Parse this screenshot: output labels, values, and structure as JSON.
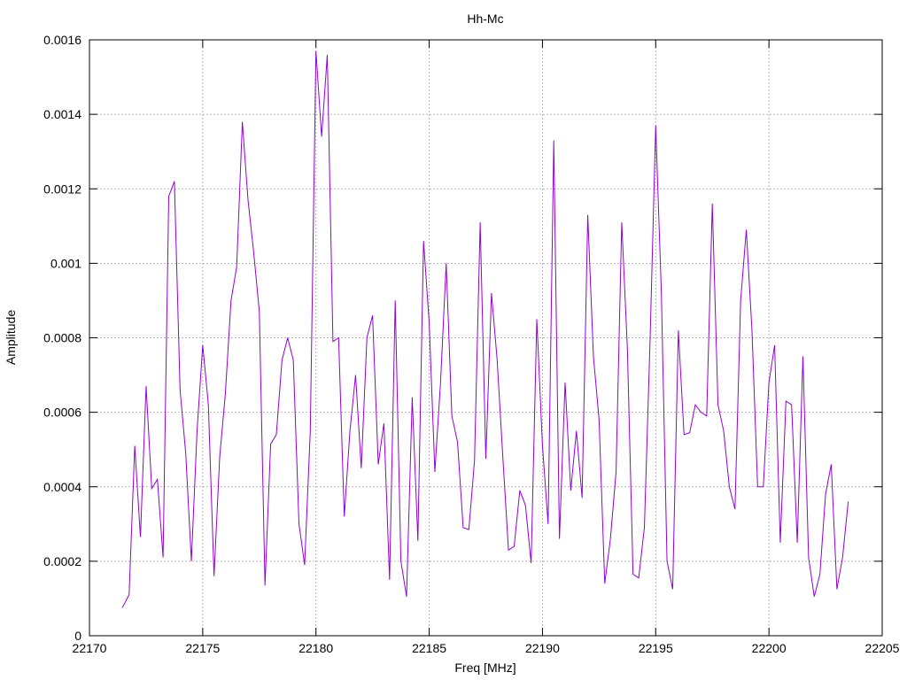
{
  "chart_data": {
    "type": "line",
    "title": "Hh-Mc",
    "xlabel": "Freq [MHz]",
    "ylabel": "Amplitude",
    "xlim": [
      22170,
      22205
    ],
    "ylim": [
      0,
      0.0016
    ],
    "xticks": [
      22170,
      22175,
      22180,
      22185,
      22190,
      22195,
      22200,
      22205
    ],
    "xtick_labels": [
      "22170",
      "22175",
      "22180",
      "22185",
      "22190",
      "22195",
      "22200",
      "22205"
    ],
    "yticks": [
      0,
      0.0002,
      0.0004,
      0.0006,
      0.0008,
      0.001,
      0.0012,
      0.0014,
      0.0016
    ],
    "ytick_labels": [
      "0",
      "0.0002",
      "0.0004",
      "0.0006",
      "0.0008",
      "0.001",
      "0.0012",
      "0.0014",
      "0.0016"
    ],
    "grid": true,
    "line_color": "#9400d3",
    "series": [
      {
        "x": [
          22171.45,
          22171.75,
          22172.0,
          22172.25,
          22172.5,
          22172.75,
          22173.0,
          22173.25,
          22173.5,
          22173.75,
          22174.0,
          22174.25,
          22174.5,
          22174.75,
          22175.0,
          22175.25,
          22175.5,
          22175.75,
          22176.0,
          22176.25,
          22176.5,
          22176.75,
          22177.0,
          22177.25,
          22177.5,
          22177.75,
          22178.0,
          22178.25,
          22178.5,
          22178.75,
          22179.0,
          22179.25,
          22179.5,
          22179.75,
          22180.0,
          22180.25,
          22180.5,
          22180.75,
          22181.0,
          22181.25,
          22181.5,
          22181.75,
          22182.0,
          22182.25,
          22182.5,
          22182.75,
          22183.0,
          22183.25,
          22183.5,
          22183.75,
          22184.0,
          22184.25,
          22184.5,
          22184.75,
          22185.0,
          22185.25,
          22185.5,
          22185.75,
          22186.0,
          22186.25,
          22186.5,
          22186.75,
          22187.0,
          22187.25,
          22187.5,
          22187.75,
          22188.0,
          22188.25,
          22188.5,
          22188.75,
          22189.0,
          22189.25,
          22189.5,
          22189.75,
          22190.0,
          22190.25,
          22190.5,
          22190.75,
          22191.0,
          22191.25,
          22191.5,
          22191.75,
          22192.0,
          22192.25,
          22192.5,
          22192.75,
          22193.0,
          22193.25,
          22193.5,
          22193.75,
          22194.0,
          22194.25,
          22194.5,
          22194.75,
          22195.0,
          22195.25,
          22195.5,
          22195.75,
          22196.0,
          22196.25,
          22196.5,
          22196.75,
          22197.0,
          22197.25,
          22197.5,
          22197.75,
          22198.0,
          22198.25,
          22198.5,
          22198.75,
          22199.0,
          22199.25,
          22199.5,
          22199.75,
          22200.0,
          22200.25,
          22200.5,
          22200.75,
          22201.0,
          22201.25,
          22201.5,
          22201.75,
          22202.0,
          22202.25,
          22202.5,
          22202.75,
          22203.0,
          22203.25,
          22203.5
        ],
        "y": [
          7.5e-05,
          0.00011,
          0.00051,
          0.000265,
          0.00067,
          0.000395,
          0.00042,
          0.00021,
          0.00118,
          0.00122,
          0.00066,
          0.00049,
          0.0002,
          0.00055,
          0.00078,
          0.00062,
          0.00016,
          0.00048,
          0.00065,
          0.0009,
          0.00099,
          0.00138,
          0.00117,
          0.00103,
          0.00087,
          0.000135,
          0.000515,
          0.00054,
          0.00074,
          0.0008,
          0.00074,
          0.0003,
          0.00019,
          0.00055,
          0.00157,
          0.00134,
          0.00156,
          0.00079,
          0.0008,
          0.00032,
          0.00055,
          0.0007,
          0.00045,
          0.0008,
          0.00086,
          0.00046,
          0.00057,
          0.00015,
          0.0009,
          0.0002,
          0.000105,
          0.00064,
          0.000255,
          0.00106,
          0.00084,
          0.00044,
          0.00068,
          0.001,
          0.00059,
          0.00052,
          0.00029,
          0.000285,
          0.00047,
          0.00111,
          0.000475,
          0.00092,
          0.00074,
          0.00048,
          0.00023,
          0.00024,
          0.00039,
          0.00035,
          0.000195,
          0.00085,
          0.00051,
          0.0003,
          0.00133,
          0.00026,
          0.00068,
          0.00039,
          0.00055,
          0.00037,
          0.00113,
          0.00075,
          0.00058,
          0.00014,
          0.00026,
          0.00044,
          0.00111,
          0.00077,
          0.000165,
          0.000155,
          0.00029,
          0.00079,
          0.00137,
          0.00092,
          0.0002,
          0.000125,
          0.00082,
          0.00054,
          0.000545,
          0.00062,
          0.0006,
          0.00059,
          0.00116,
          0.00062,
          0.00055,
          0.0004,
          0.00034,
          0.0009,
          0.00109,
          0.00082,
          0.0004,
          0.0004,
          0.00068,
          0.00078,
          0.00025,
          0.00063,
          0.00062,
          0.00025,
          0.00075,
          0.00021,
          0.000105,
          0.000165,
          0.00038,
          0.00046,
          0.000125,
          0.00021,
          0.00036
        ]
      }
    ]
  }
}
